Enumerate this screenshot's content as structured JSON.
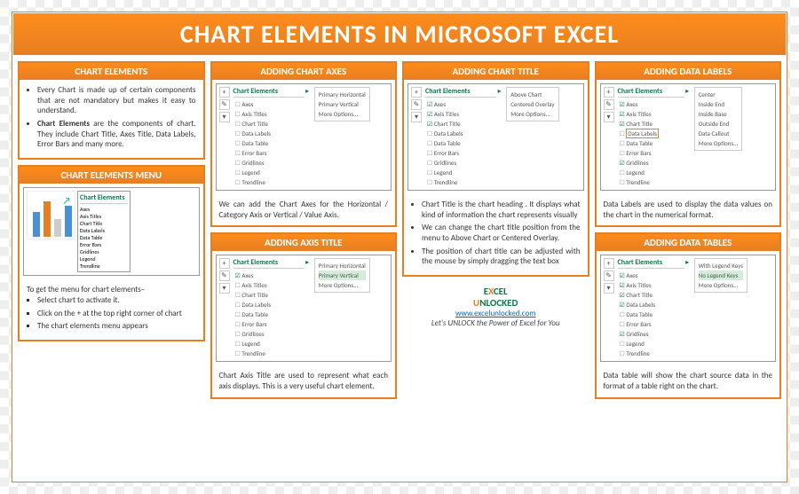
{
  "main_title": "CHART ELEMENTS IN MICROSOFT EXCEL",
  "cards": {
    "intro": {
      "title": "CHART ELEMENTS",
      "items": [
        "Every Chart is made up of certain components that are not mandatory but makes it easy to understand.",
        "<b>Chart Elements</b> are the components of chart. They include Chart Title, Axes Title, Data Labels, Error Bars and many more."
      ]
    },
    "menu": {
      "title": "CHART ELEMENTS MENU",
      "lead": "To get the menu for chart elements–",
      "items": [
        "Select chart to activate it.",
        "Click on the + at the top right corner of chart",
        "The chart elements menu appears"
      ]
    },
    "axes": {
      "title": "ADDING CHART AXES",
      "body": "We can add the Chart Axes for the Horizontal / Category Axis or Vertical / Value Axis."
    },
    "axis_title": {
      "title": "ADDING AXIS TITLE",
      "body": "Chart Axis Title are used to represent what each axis displays. This is a very useful chart element."
    },
    "chart_title": {
      "title": "ADDING CHART TITLE",
      "items": [
        "Chart Title is the chart heading . It displays what kind of information the chart represents visually",
        "We can change the chart title position from the menu to Above Chart or Centered Overlay.",
        "The position of chart title can be adjusted with the mouse by simply dragging the text box"
      ]
    },
    "data_labels": {
      "title": "ADDING DATA LABELS",
      "body": "Data Labels are used to display the data values on the chart in the numerical format."
    },
    "data_tables": {
      "title": "ADDING DATA TABLES",
      "body": "Data table will show the chart source data in the format of a table right on the chart."
    }
  },
  "ce_menu": {
    "header": "Chart Elements",
    "items": [
      "Axes",
      "Axis Titles",
      "Chart Title",
      "Data Labels",
      "Data Table",
      "Error Bars",
      "Gridlines",
      "Legend",
      "Trendline"
    ]
  },
  "submenus": {
    "axes": [
      "Primary Horizontal",
      "Primary Vertical",
      "More Options..."
    ],
    "axis_title": [
      "Primary Horizontal",
      "Primary Vertical",
      "More Options..."
    ],
    "chart_title": [
      "Above Chart",
      "Centered Overlay",
      "More Options..."
    ],
    "data_labels": [
      "Center",
      "Inside End",
      "Inside Base",
      "Outside End",
      "Data Callout",
      "More Options..."
    ],
    "data_tables": [
      "With Legend Keys",
      "No Legend Keys",
      "More Options..."
    ]
  },
  "footer": {
    "logo1": "E",
    "logo2": "X",
    "logo3": "CEL",
    "logo4": "U",
    "logo5": "NLOCKED",
    "url": "www.excelunlocked.com",
    "tag": "Let's UNLOCK the Power of Excel for You"
  }
}
